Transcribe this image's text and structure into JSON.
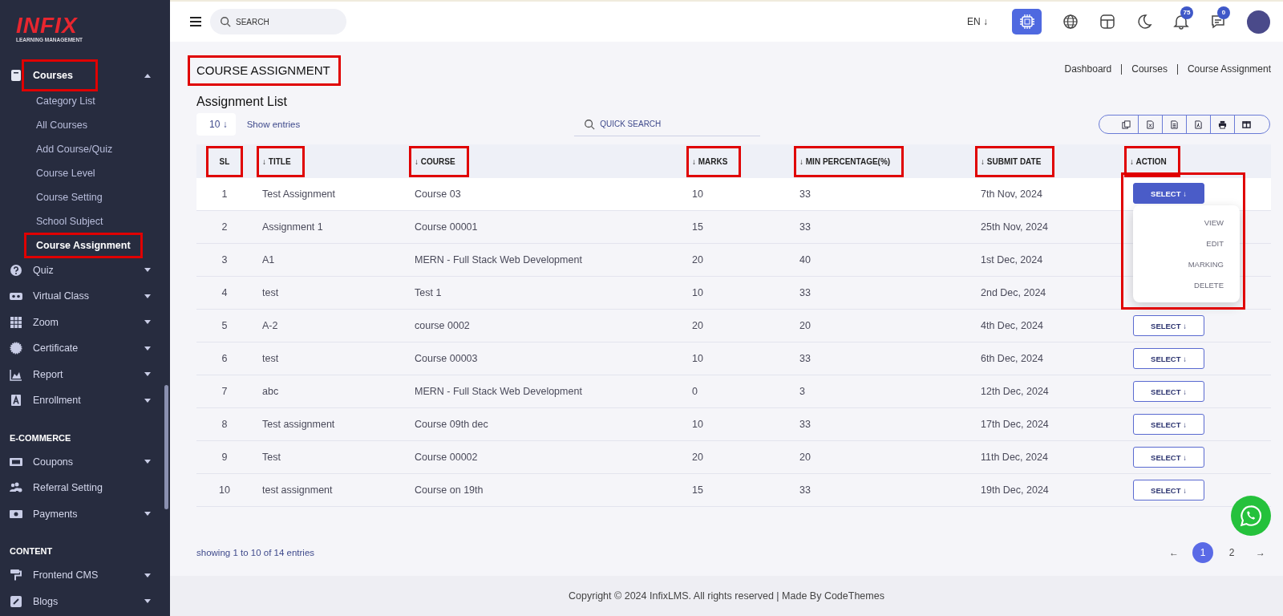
{
  "logo": {
    "brand": "INFIX",
    "tagline": "LEARNING MANAGEMENT"
  },
  "sidebar": {
    "sections": [
      {
        "items": [
          {
            "label": "Courses",
            "expanded": true,
            "highlighted": true,
            "children": [
              {
                "label": "Category List",
                "selected": false,
                "highlighted": false
              },
              {
                "label": "All Courses",
                "selected": false,
                "highlighted": false
              },
              {
                "label": "Add Course/Quiz",
                "selected": false,
                "highlighted": false
              },
              {
                "label": "Course Level",
                "selected": false,
                "highlighted": false
              },
              {
                "label": "Course Setting",
                "selected": false,
                "highlighted": false
              },
              {
                "label": "School Subject",
                "selected": false,
                "highlighted": false
              },
              {
                "label": "Course Assignment",
                "selected": true,
                "highlighted": true
              }
            ]
          },
          {
            "label": "Quiz",
            "expanded": false,
            "highlighted": false
          },
          {
            "label": "Virtual Class",
            "expanded": false,
            "highlighted": false
          },
          {
            "label": "Zoom",
            "expanded": false,
            "highlighted": false
          },
          {
            "label": "Certificate",
            "expanded": false,
            "highlighted": false
          },
          {
            "label": "Report",
            "expanded": false,
            "highlighted": false
          },
          {
            "label": "Enrollment",
            "expanded": false,
            "highlighted": false
          }
        ]
      },
      {
        "heading": "E-COMMERCE",
        "items": [
          {
            "label": "Coupons",
            "expanded": false,
            "highlighted": false
          },
          {
            "label": "Referral Setting",
            "highlighted": false
          },
          {
            "label": "Payments",
            "expanded": false,
            "highlighted": false
          }
        ]
      },
      {
        "heading": "CONTENT",
        "items": [
          {
            "label": "Frontend CMS",
            "expanded": false,
            "highlighted": false
          },
          {
            "label": "Blogs",
            "expanded": false,
            "highlighted": false
          }
        ]
      }
    ]
  },
  "topbar": {
    "search": {
      "placeholder": "SEARCH"
    },
    "language": "EN ↓",
    "notifications": "75",
    "messages": "0"
  },
  "page": {
    "title": "COURSE ASSIGNMENT",
    "title_highlighted": true,
    "breadcrumb": [
      "Dashboard",
      "Courses",
      "Course Assignment"
    ],
    "list_title": "Assignment List",
    "page_size": "10 ↓",
    "show_entries": "Show entries",
    "quick_search": {
      "placeholder": "QUICK SEARCH"
    }
  },
  "table": {
    "columns": [
      {
        "label": "SL",
        "highlighted": true
      },
      {
        "label": "↓ TITLE",
        "highlighted": true
      },
      {
        "label": "↓ COURSE",
        "highlighted": true
      },
      {
        "label": "↓ MARKS",
        "highlighted": true
      },
      {
        "label": "↓ MIN PERCENTAGE(%)",
        "highlighted": true
      },
      {
        "label": "↓ SUBMIT DATE",
        "highlighted": true
      },
      {
        "label": "↓ ACTION",
        "highlighted": true
      }
    ],
    "action_menu": {
      "items": [
        "VIEW",
        "EDIT",
        "MARKING",
        "DELETE"
      ],
      "highlighted": true
    },
    "rows": [
      {
        "cells": [
          "1",
          "Test Assignment",
          "Course 03",
          "10",
          "33",
          "7th Nov, 2024"
        ],
        "action": "SELECT ↓",
        "menu_open": true
      },
      {
        "cells": [
          "2",
          "Assignment 1",
          "Course 00001",
          "15",
          "33",
          "25th Nov, 2024"
        ]
      },
      {
        "cells": [
          "3",
          "A1",
          "MERN - Full Stack Web Development",
          "20",
          "40",
          "1st Dec, 2024"
        ]
      },
      {
        "cells": [
          "4",
          "test",
          "Test 1",
          "10",
          "33",
          "2nd Dec, 2024"
        ]
      },
      {
        "cells": [
          "5",
          "A-2",
          "course 0002",
          "20",
          "20",
          "4th Dec, 2024"
        ],
        "action": "SELECT ↓",
        "menu_open": false
      },
      {
        "cells": [
          "6",
          "test",
          "Course 00003",
          "10",
          "33",
          "6th Dec, 2024"
        ],
        "action": "SELECT ↓",
        "menu_open": false
      },
      {
        "cells": [
          "7",
          "abc",
          "MERN - Full Stack Web Development",
          "0",
          "3",
          "12th Dec, 2024"
        ],
        "action": "SELECT ↓",
        "menu_open": false
      },
      {
        "cells": [
          "8",
          "Test assignment",
          "Course 09th dec",
          "10",
          "33",
          "17th Dec, 2024"
        ],
        "action": "SELECT ↓",
        "menu_open": false
      },
      {
        "cells": [
          "9",
          "Test",
          "Course 00002",
          "20",
          "20",
          "11th Dec, 2024"
        ],
        "action": "SELECT ↓",
        "menu_open": false
      },
      {
        "cells": [
          "10",
          "test assignment",
          "Course on 19th",
          "15",
          "33",
          "19th Dec, 2024"
        ],
        "action": "SELECT ↓",
        "menu_open": false
      }
    ]
  },
  "summary": "showing 1 to 10 of 14 entries",
  "pagination": {
    "prev": "←",
    "next": "→",
    "pages": [
      {
        "label": "1",
        "selected": true
      },
      {
        "label": "2",
        "selected": false
      }
    ]
  },
  "footer": "Copyright © 2024 InfixLMS. All rights reserved | Made By CodeThemes"
}
